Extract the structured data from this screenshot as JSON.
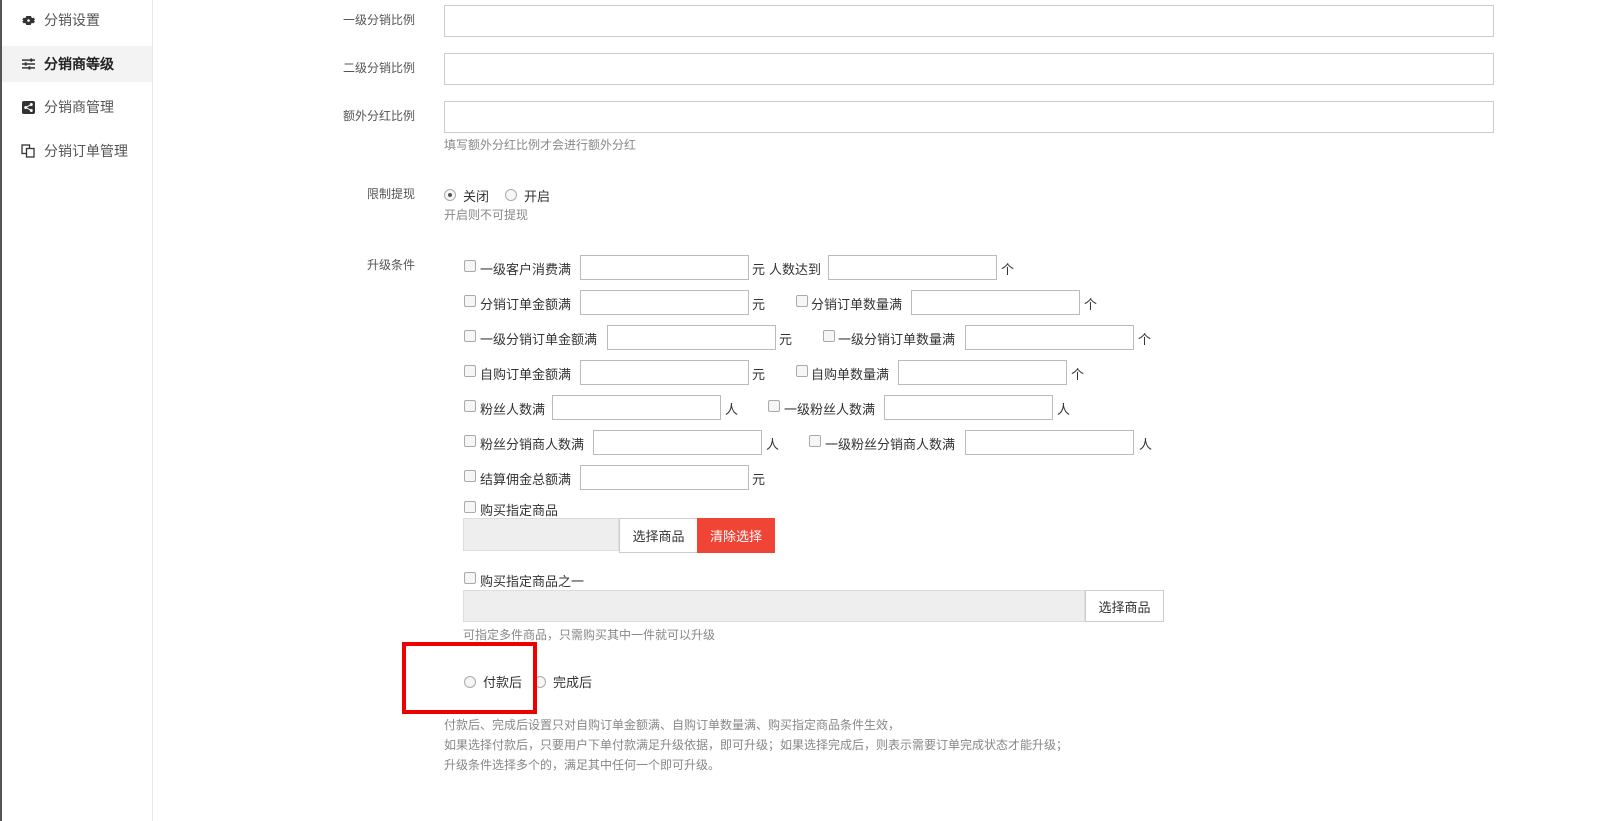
{
  "sidebar": {
    "items": [
      {
        "label": "分销设置",
        "icon": "gear-icon"
      },
      {
        "label": "分销商等级",
        "icon": "sliders-icon"
      },
      {
        "label": "分销商管理",
        "icon": "share-icon"
      },
      {
        "label": "分销订单管理",
        "icon": "copy-icon"
      }
    ]
  },
  "form": {
    "level1_ratio_label": "一级分销比例",
    "level2_ratio_label": "二级分销比例",
    "extra_ratio_label": "额外分红比例",
    "extra_ratio_hint": "填写额外分红比例才会进行额外分红",
    "limit_label": "限制提现",
    "limit_off": "关闭",
    "limit_on": "开启",
    "limit_hint": "开启则不可提现",
    "upgrade_label": "升级条件"
  },
  "conditions": {
    "c1": "一级客户消费满",
    "c1_unit": "元",
    "c1b": "人数达到",
    "c1b_unit": "个",
    "c2": "分销订单金额满",
    "c2_unit": "元",
    "c2b": "分销订单数量满",
    "c2b_unit": "个",
    "c3": "一级分销订单金额满",
    "c3_unit": "元",
    "c3b": "一级分销订单数量满",
    "c3b_unit": "个",
    "c4": "自购订单金额满",
    "c4_unit": "元",
    "c4b": "自购单数量满",
    "c4b_unit": "个",
    "c5": "粉丝人数满",
    "c5_unit": "人",
    "c5b": "一级粉丝人数满",
    "c5b_unit": "人",
    "c6": "粉丝分销商人数满",
    "c6_unit": "人",
    "c6b": "一级粉丝分销商人数满",
    "c6b_unit": "人",
    "c7": "结算佣金总额满",
    "c7_unit": "元",
    "c8": "购买指定商品",
    "select_goods": "选择商品",
    "clear_select": "清除选择",
    "c9": "购买指定商品之一",
    "select_goods2": "选择商品",
    "c9_hint": "可指定多件商品，只需购买其中一件就可以升级"
  },
  "timing": {
    "after_pay": "付款后",
    "after_complete": "完成后",
    "hint1": "付款后、完成后设置只对自购订单金额满、自购订单数量满、购买指定商品条件生效，",
    "hint2": "如果选择付款后，只要用户下单付款满足升级依据，即可升级；如果选择完成后，则表示需要订单完成状态才能升级；",
    "hint3": "升级条件选择多个的，满足其中任何一个即可升级。"
  },
  "colors": {
    "danger": "#f04437",
    "highlight": "#ee0000"
  }
}
